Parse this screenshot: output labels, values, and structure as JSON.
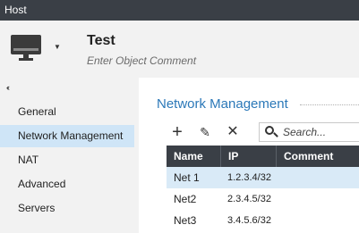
{
  "window": {
    "title": "Host"
  },
  "header": {
    "object_name": "Test",
    "comment_placeholder": "Enter Object Comment",
    "icon": "monitor-icon"
  },
  "sidebar": {
    "collapse_glyph": "‹‹",
    "items": [
      {
        "label": "General",
        "active": false
      },
      {
        "label": "Network Management",
        "active": true
      },
      {
        "label": "NAT",
        "active": false
      },
      {
        "label": "Advanced",
        "active": false
      },
      {
        "label": "Servers",
        "active": false
      }
    ]
  },
  "main": {
    "section_title": "Network Management",
    "toolbar": {
      "add_glyph": "+",
      "edit_glyph": "✎",
      "delete_glyph": "✕",
      "search_placeholder": "Search..."
    },
    "table": {
      "columns": [
        "Name",
        "IP",
        "Comment"
      ],
      "rows": [
        {
          "name": "Net 1",
          "ip": "1.2.3.4/32",
          "comment": "",
          "selected": true
        },
        {
          "name": "Net2",
          "ip": "2.3.4.5/32",
          "comment": "",
          "selected": false
        },
        {
          "name": "Net3",
          "ip": "3.4.5.6/32",
          "comment": "",
          "selected": false
        }
      ]
    }
  },
  "colors": {
    "titlebar": "#3a3f46",
    "accent": "#2b78b8",
    "selection": "#cfe5f7"
  }
}
